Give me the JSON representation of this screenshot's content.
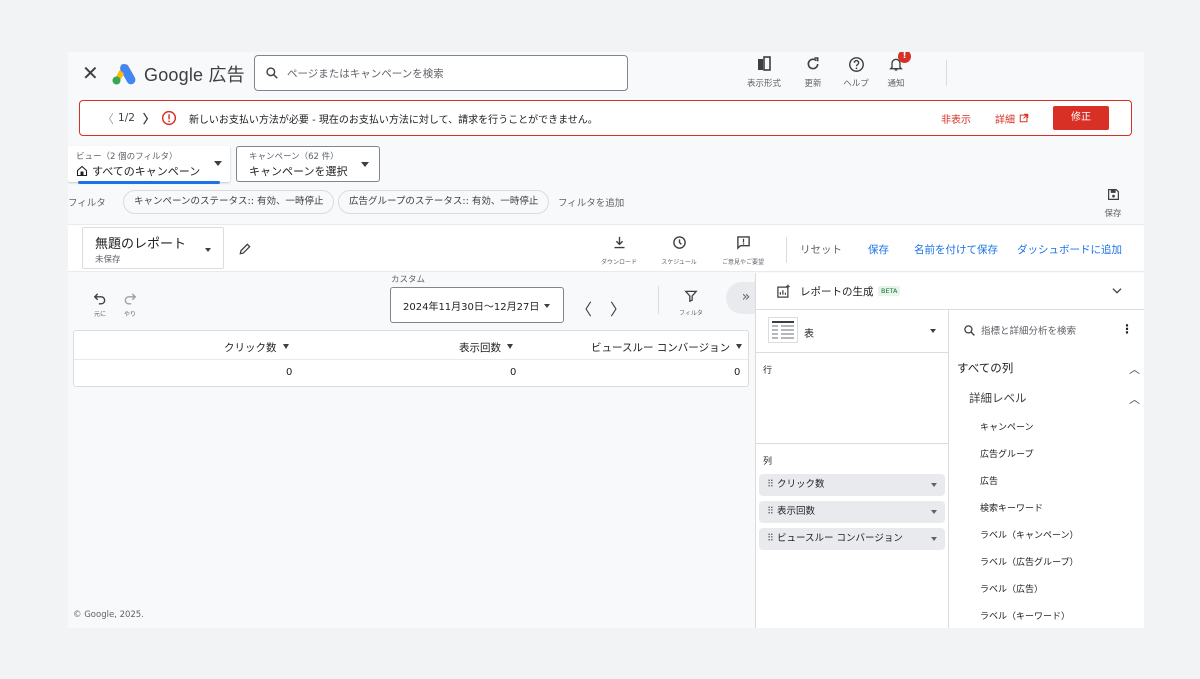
{
  "header": {
    "app_name": "Google 広告",
    "search_placeholder": "ページまたはキャンペーンを検索",
    "buttons": [
      {
        "label": "表示形式",
        "icon": "appearance-icon"
      },
      {
        "label": "更新",
        "icon": "refresh-icon"
      },
      {
        "label": "ヘルプ",
        "icon": "help-icon"
      },
      {
        "label": "通知",
        "icon": "bell-icon"
      }
    ],
    "notification_badge": "!"
  },
  "alert": {
    "pager": "1/2",
    "message": "新しいお支払い方法が必要 - 現在のお支払い方法に対して、請求を行うことができません。",
    "dismiss": "非表示",
    "details": "詳細",
    "fix": "修正"
  },
  "view_selector": {
    "caption": "ビュー（2 個のフィルタ）",
    "value": "すべてのキャンペーン"
  },
  "campaign_selector": {
    "caption": "キャンペーン（62 件）",
    "value": "キャンペーンを選択"
  },
  "filters": {
    "label": "フィルタ",
    "chips": [
      "キャンペーンのステータス:: 有効、一時停止",
      "広告グループのステータス:: 有効、一時停止"
    ],
    "add": "フィルタを追加",
    "save": "保存"
  },
  "report": {
    "title": "無題のレポート",
    "subtitle": "未保存",
    "tools": [
      {
        "label": "ダウンロード",
        "icon": "download-icon"
      },
      {
        "label": "スケジュール",
        "icon": "schedule-icon"
      },
      {
        "label": "ご意見やご要望",
        "icon": "feedback-icon"
      }
    ],
    "actions": {
      "reset": "リセット",
      "save": "保存",
      "save_as": "名前を付けて保存",
      "add_dashboard": "ダッシュボードに追加"
    }
  },
  "toolbar": {
    "undo": "元に",
    "redo": "やり",
    "date_caption": "カスタム",
    "date_range": "2024年11月30日〜12月27日",
    "filter": "フィルタ"
  },
  "table": {
    "columns": [
      "クリック数",
      "表示回数",
      "ビュースルー コンバージョン"
    ],
    "values": [
      "0",
      "0",
      "0"
    ]
  },
  "footer": {
    "copyright": "© Google, 2025."
  },
  "panel": {
    "title": "レポートの生成",
    "badge": "BETA",
    "viz_type": "表",
    "rows_label": "行",
    "columns_label": "列",
    "column_chips": [
      "クリック数",
      "表示回数",
      "ビュースルー コンバージョン"
    ],
    "search_placeholder": "指標と詳細分析を検索",
    "all_columns": "すべての列",
    "detail_level": "詳細レベル",
    "dimensions": [
      "キャンペーン",
      "広告グループ",
      "広告",
      "検索キーワード",
      "ラベル（キャンペーン）",
      "ラベル（広告グループ）",
      "ラベル（広告）",
      "ラベル（キーワード）"
    ]
  },
  "colors": {
    "accent": "#1a73e8",
    "error": "#d93025"
  }
}
